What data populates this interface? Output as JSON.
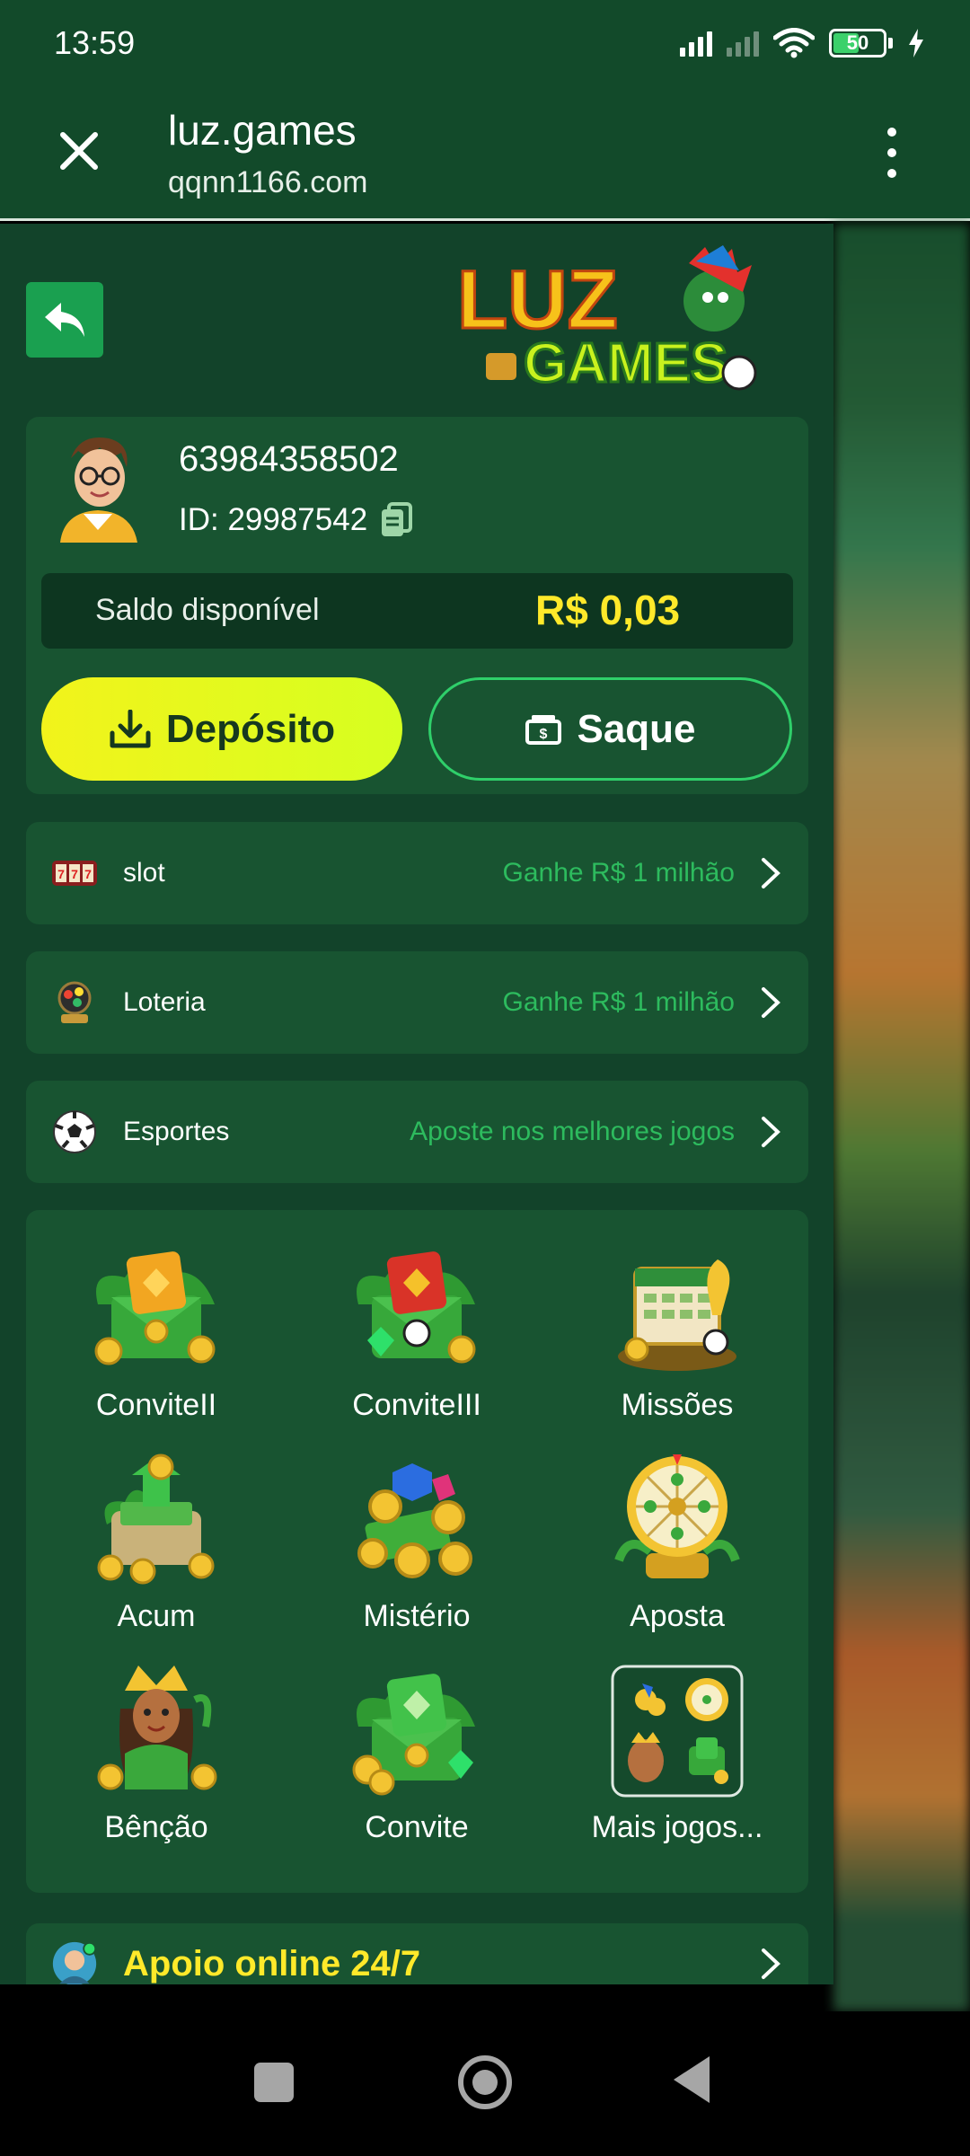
{
  "status_bar": {
    "time": "13:59",
    "battery_level": "50",
    "icons": [
      "signal-icon",
      "signal-off-icon",
      "wifi-icon",
      "battery-icon",
      "charging-icon"
    ]
  },
  "browser": {
    "title": "luz.games",
    "url": "qqnn1166.com"
  },
  "brand": {
    "logo_text": "LUZ GAMES"
  },
  "profile": {
    "phone": "63984358502",
    "id_text": "ID: 29987542",
    "balance_label": "Saldo disponível",
    "balance_value": "R$ 0,03",
    "deposit_label": "Depósito",
    "withdraw_label": "Saque"
  },
  "categories": [
    {
      "label": "slot",
      "promo": "Ganhe R$ 1 milhão"
    },
    {
      "label": "Loteria",
      "promo": "Ganhe R$ 1 milhão"
    },
    {
      "label": "Esportes",
      "promo": "Aposte nos melhores jogos"
    }
  ],
  "activities": [
    {
      "label": "ConviteII"
    },
    {
      "label": "ConviteIII"
    },
    {
      "label": "Missões"
    },
    {
      "label": "Acum"
    },
    {
      "label": "Mistério"
    },
    {
      "label": "Aposta"
    },
    {
      "label": "Bênção"
    },
    {
      "label": "Convite"
    },
    {
      "label": "Mais jogos..."
    }
  ],
  "support": {
    "label": "Apoio online 24/7"
  },
  "colors": {
    "panel": "#12432a",
    "card": "#185431",
    "accent_yellow": "#ffe92a",
    "accent_green": "#2dbb5e"
  }
}
